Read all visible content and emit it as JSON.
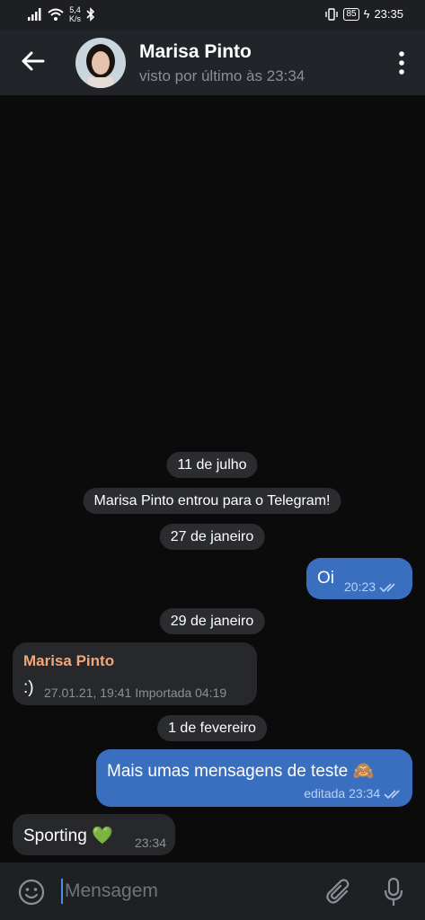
{
  "status_bar": {
    "network_speed_value": "5,4",
    "network_speed_unit": "K/s",
    "battery": "85",
    "time": "23:35"
  },
  "header": {
    "name": "Marisa Pinto",
    "last_seen": "visto por último às 23:34"
  },
  "dates": {
    "d1": "11 de julho",
    "d2": "27 de janeiro",
    "d3": "29 de janeiro",
    "d4": "1 de fevereiro"
  },
  "service": {
    "joined": "Marisa Pinto entrou para o Telegram!"
  },
  "messages": {
    "m1": {
      "text": "Oi",
      "time": "20:23"
    },
    "m2": {
      "sender": "Marisa Pinto",
      "text": ":)",
      "meta": "27.01.21, 19:41 Importada 04:19"
    },
    "m3": {
      "text": "Mais umas mensagens de teste 🙈",
      "meta": "editada 23:34"
    },
    "m4": {
      "text": "Sporting 💚",
      "time": "23:34"
    }
  },
  "input": {
    "placeholder": "Mensagem"
  },
  "colors": {
    "outgoing_bubble": "#3a6fc0",
    "incoming_bubble": "#26282b",
    "sender_name": "#f0a77a",
    "accent": "#4a90e2"
  }
}
